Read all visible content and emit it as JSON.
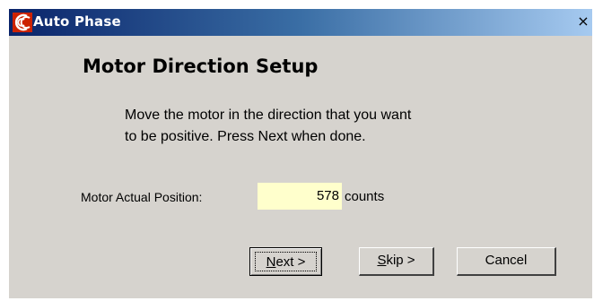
{
  "window": {
    "title": "Auto Phase",
    "close_label": "×"
  },
  "heading": "Motor Direction Setup",
  "instructions": {
    "line1": "Move the motor in the direction that you want",
    "line2": "to be positive.  Press Next when done."
  },
  "position": {
    "label": "Motor Actual Position:",
    "value": "578",
    "unit": "counts"
  },
  "buttons": {
    "next": {
      "mnemonic": "N",
      "rest": "ext >"
    },
    "skip": {
      "mnemonic": "S",
      "rest": "kip >"
    },
    "cancel": {
      "label": "Cancel"
    }
  },
  "colors": {
    "dialog_bg": "#d6d3ce",
    "title_bar_start": "#0a246a",
    "title_bar_end": "#a6caf0",
    "value_field_bg": "#ffffcc",
    "app_icon": "#cc2200"
  },
  "icons": {
    "app_icon": "copley-logo-icon",
    "close_icon": "close-icon"
  }
}
